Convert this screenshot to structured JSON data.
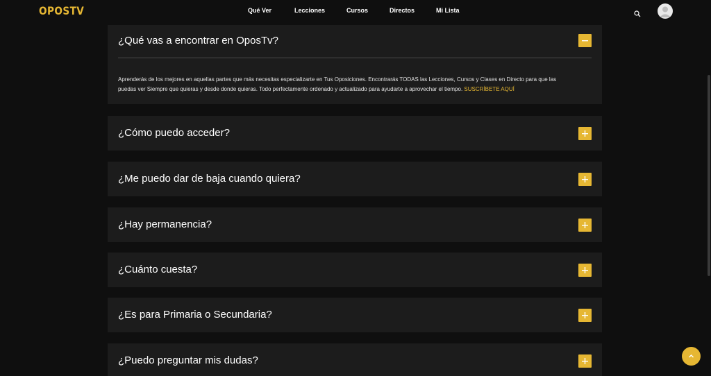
{
  "header": {
    "logo": "OPOSTV",
    "nav": [
      "Qué Ver",
      "Lecciones",
      "Cursos",
      "Directos",
      "Mi Lista"
    ]
  },
  "icons": {
    "search": "search-icon",
    "avatar": "user-avatar-icon",
    "toggle_open": "minus-icon",
    "toggle_closed": "plus-icon",
    "back_to_top": "chevron-up-icon"
  },
  "colors": {
    "accent": "#e6b733",
    "panel": "#1c1c1c",
    "background": "#0f0f0f"
  },
  "faq": {
    "items": [
      {
        "question": "¿Qué vas a encontrar en OposTv?",
        "expanded": true
      },
      {
        "question": "¿Cómo puedo acceder?",
        "expanded": false
      },
      {
        "question": "¿Me puedo dar de baja cuando quiera?",
        "expanded": false
      },
      {
        "question": "¿Hay permanencia?",
        "expanded": false
      },
      {
        "question": "¿Cuánto cuesta?",
        "expanded": false
      },
      {
        "question": "¿Es para Primaria o Secundaria?",
        "expanded": false
      },
      {
        "question": "¿Puedo preguntar mis dudas?",
        "expanded": false
      }
    ],
    "answer_line1": "Aprenderás de los mejores en aquellas partes que más necesitas especializarte en Tus Oposiciones. Encontrarás TODAS las Lecciones, Cursos y Clases en Directo para que las",
    "answer_line2": "puedas ver Siempre que quieras y desde donde quieras. Todo perfectamente ordenado y actualizado para ayudarte a aprovechar el tiempo.",
    "answer_link": "SUSCRÍBETE AQUÍ"
  }
}
